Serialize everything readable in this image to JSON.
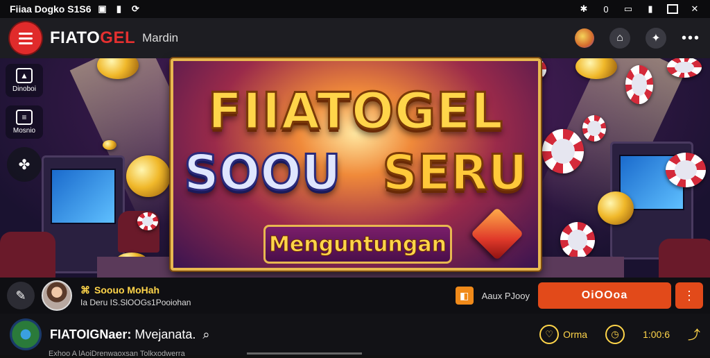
{
  "status_bar": {
    "left_text": "Fiiaa Dogko S1S6",
    "right_badge": "0"
  },
  "app_bar": {
    "brand_white": "FIATO",
    "brand_red": "GEL",
    "subtitle": "Mardin"
  },
  "side_rail": {
    "items": [
      {
        "label": "Dinoboi",
        "icon": "game-icon"
      },
      {
        "label": "Mosnio",
        "icon": "tv-icon"
      }
    ]
  },
  "banner": {
    "title": "FIIATOGEL",
    "word_left": "SOOU",
    "word_right": "SERU",
    "plate": "Menguntungan"
  },
  "promo": {
    "title": "Soouo MoHah",
    "subtitle": "Ia  Deru IS.SlOOGs1Pooiohan",
    "note": "Aaux PJooy",
    "cta_label": "OiOOoa"
  },
  "bottom_bar": {
    "name_bold": "FIATOIGNaer:",
    "name_rest": " Mvejanata.",
    "stat1": "Orma",
    "stat2": "1:00:6",
    "ticker": "Exhoo A lAoiDrenwaoxsan Tolkxodwerra"
  },
  "colors": {
    "accent_red": "#e02b2b",
    "cta_orange": "#e24a1a",
    "gold": "#ffd54a"
  }
}
